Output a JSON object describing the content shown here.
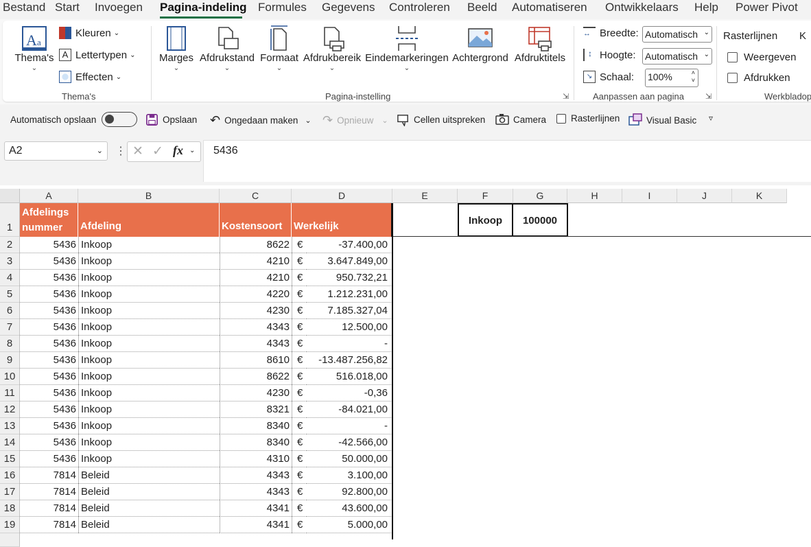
{
  "menu": {
    "tabs": [
      "Bestand",
      "Start",
      "Invoegen",
      "Pagina-indeling",
      "Formules",
      "Gegevens",
      "Controleren",
      "Beeld",
      "Automatiseren",
      "Ontwikkelaars",
      "Help",
      "Power Pivot"
    ],
    "active": "Pagina-indeling"
  },
  "ribbon": {
    "themes_group": {
      "label": "Thema's",
      "themes_button": "Thema's",
      "colors": "Kleuren",
      "fonts": "Lettertypen",
      "effects": "Effecten"
    },
    "page_setup_group": {
      "label": "Pagina-instelling",
      "margins": "Marges",
      "orientation": "Afdrukstand",
      "size": "Formaat",
      "print_area": "Afdrukbereik",
      "breaks": "Eindemarkeringen",
      "background": "Achtergrond",
      "print_titles": "Afdruktitels"
    },
    "scale_group": {
      "label": "Aanpassen aan pagina",
      "width_label": "Breedte:",
      "width_value": "Automatisch",
      "height_label": "Hoogte:",
      "height_value": "Automatisch",
      "scale_label": "Schaal:",
      "scale_value": "100%"
    },
    "sheet_options_group": {
      "label": "Werkbladop",
      "gridlines_title": "Rasterlijnen",
      "view": "Weergeven",
      "print": "Afdrukken"
    }
  },
  "qat": {
    "autosave": "Automatisch opslaan",
    "save": "Opslaan",
    "undo": "Ongedaan maken",
    "redo": "Opnieuw",
    "speak": "Cellen uitspreken",
    "camera": "Camera",
    "gridlines": "Rasterlijnen",
    "vba": "Visual Basic"
  },
  "formula_bar": {
    "name_box": "A2",
    "formula": "5436",
    "fx": "fx"
  },
  "columns": [
    "A",
    "B",
    "C",
    "D",
    "E",
    "F",
    "G",
    "H",
    "I",
    "J",
    "K"
  ],
  "header_row": {
    "row": "1",
    "a_line1": "Afdelings",
    "a_line2": "nummer",
    "b": "Afdeling",
    "c": "Kostensoort",
    "d": "Werkelijk",
    "f": "Inkoop",
    "g": "100000"
  },
  "rows": [
    {
      "r": "2",
      "a": "5436",
      "b": "Inkoop",
      "c": "8622",
      "cur": "€",
      "d": "-37.400,00"
    },
    {
      "r": "3",
      "a": "5436",
      "b": "Inkoop",
      "c": "4210",
      "cur": "€",
      "d": "3.647.849,00"
    },
    {
      "r": "4",
      "a": "5436",
      "b": "Inkoop",
      "c": "4210",
      "cur": "€",
      "d": "950.732,21"
    },
    {
      "r": "5",
      "a": "5436",
      "b": "Inkoop",
      "c": "4220",
      "cur": "€",
      "d": "1.212.231,00"
    },
    {
      "r": "6",
      "a": "5436",
      "b": "Inkoop",
      "c": "4230",
      "cur": "€",
      "d": "7.185.327,04"
    },
    {
      "r": "7",
      "a": "5436",
      "b": "Inkoop",
      "c": "4343",
      "cur": "€",
      "d": "12.500,00"
    },
    {
      "r": "8",
      "a": "5436",
      "b": "Inkoop",
      "c": "4343",
      "cur": "€",
      "d": "-   "
    },
    {
      "r": "9",
      "a": "5436",
      "b": "Inkoop",
      "c": "8610",
      "cur": "€",
      "d": "-13.487.256,82"
    },
    {
      "r": "10",
      "a": "5436",
      "b": "Inkoop",
      "c": "8622",
      "cur": "€",
      "d": "516.018,00"
    },
    {
      "r": "11",
      "a": "5436",
      "b": "Inkoop",
      "c": "4230",
      "cur": "€",
      "d": "-0,36"
    },
    {
      "r": "12",
      "a": "5436",
      "b": "Inkoop",
      "c": "8321",
      "cur": "€",
      "d": "-84.021,00"
    },
    {
      "r": "13",
      "a": "5436",
      "b": "Inkoop",
      "c": "8340",
      "cur": "€",
      "d": "-   "
    },
    {
      "r": "14",
      "a": "5436",
      "b": "Inkoop",
      "c": "8340",
      "cur": "€",
      "d": "-42.566,00"
    },
    {
      "r": "15",
      "a": "5436",
      "b": "Inkoop",
      "c": "4310",
      "cur": "€",
      "d": "50.000,00"
    },
    {
      "r": "16",
      "a": "7814",
      "b": "Beleid",
      "c": "4343",
      "cur": "€",
      "d": "3.100,00"
    },
    {
      "r": "17",
      "a": "7814",
      "b": "Beleid",
      "c": "4343",
      "cur": "€",
      "d": "92.800,00"
    },
    {
      "r": "18",
      "a": "7814",
      "b": "Beleid",
      "c": "4341",
      "cur": "€",
      "d": "43.600,00"
    },
    {
      "r": "19",
      "a": "7814",
      "b": "Beleid",
      "c": "4341",
      "cur": "€",
      "d": "5.000,00"
    }
  ],
  "colors": {
    "header_fill": "#e8704b",
    "accent": "#1e7145"
  }
}
